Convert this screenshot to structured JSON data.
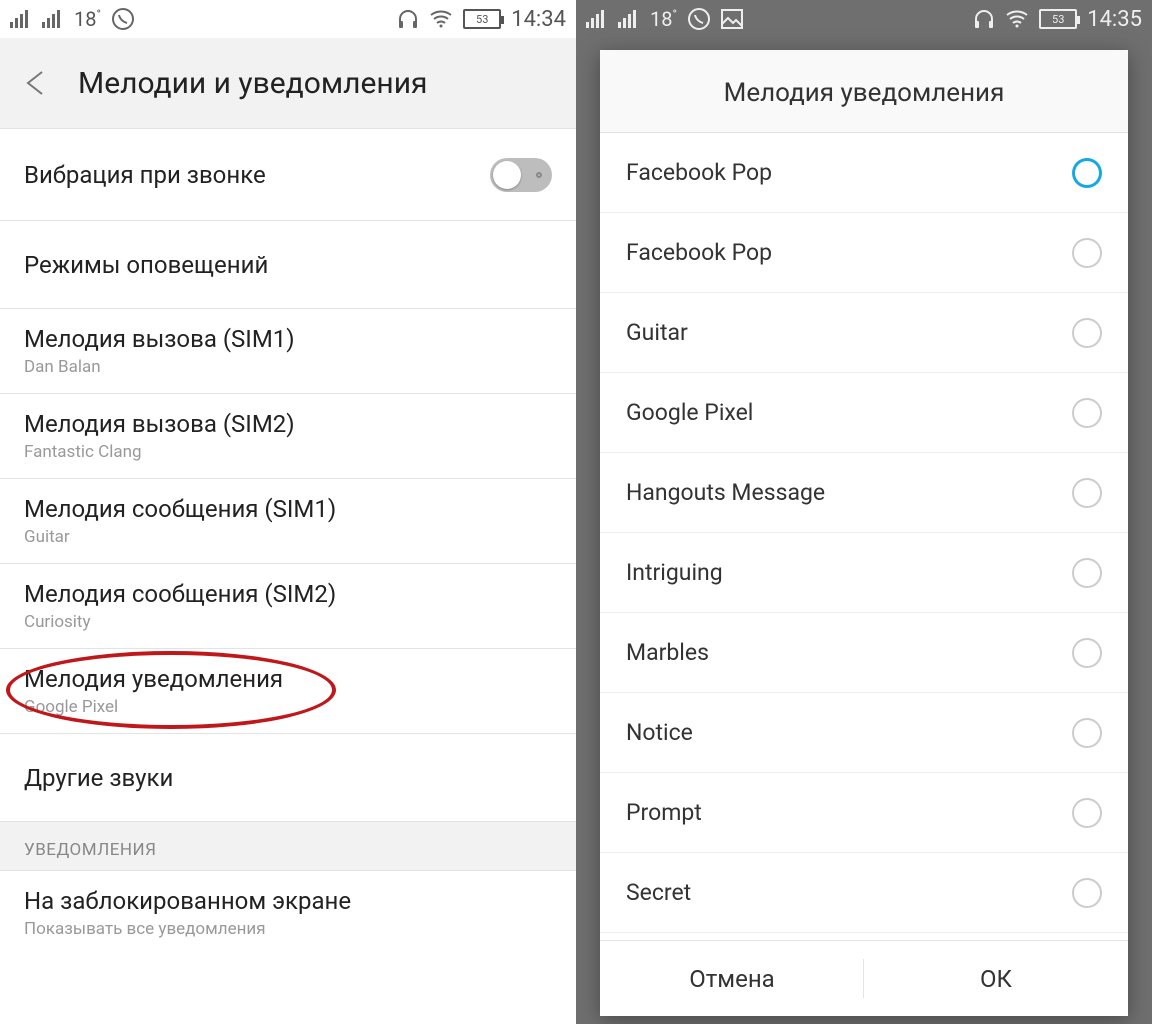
{
  "left": {
    "status": {
      "temp": "18",
      "time": "14:34",
      "battery": "53"
    },
    "header": {
      "title": "Мелодии и уведомления"
    },
    "items": {
      "vibrate": "Вибрация при звонке",
      "alert_modes": "Режимы оповещений",
      "ringtone_sim1_t": "Мелодия вызова (SIM1)",
      "ringtone_sim1_s": "Dan Balan",
      "ringtone_sim2_t": "Мелодия вызова (SIM2)",
      "ringtone_sim2_s": "Fantastic Clang",
      "msg_sim1_t": "Мелодия сообщения (SIM1)",
      "msg_sim1_s": "Guitar",
      "msg_sim2_t": "Мелодия сообщения (SIM2)",
      "msg_sim2_s": "Curiosity",
      "notif_t": "Мелодия уведомления",
      "notif_s": "Google Pixel",
      "other_sounds": "Другие звуки",
      "section_notif": "УВЕДОМЛЕНИЯ",
      "lock_screen_t": "На заблокированном экране",
      "lock_screen_s": "Показывать все уведомления"
    }
  },
  "right": {
    "status": {
      "temp": "18",
      "time": "14:35",
      "battery": "53"
    },
    "dialog": {
      "title": "Мелодия уведомления",
      "options": [
        {
          "label": "Facebook Pop",
          "selected": true
        },
        {
          "label": "Facebook Pop",
          "selected": false
        },
        {
          "label": "Guitar",
          "selected": false
        },
        {
          "label": "Google Pixel",
          "selected": false
        },
        {
          "label": "Hangouts Message",
          "selected": false
        },
        {
          "label": "Intriguing",
          "selected": false
        },
        {
          "label": "Marbles",
          "selected": false
        },
        {
          "label": "Notice",
          "selected": false
        },
        {
          "label": "Prompt",
          "selected": false
        },
        {
          "label": "Secret",
          "selected": false
        }
      ],
      "cancel": "Отмена",
      "ok": "ОК"
    }
  }
}
